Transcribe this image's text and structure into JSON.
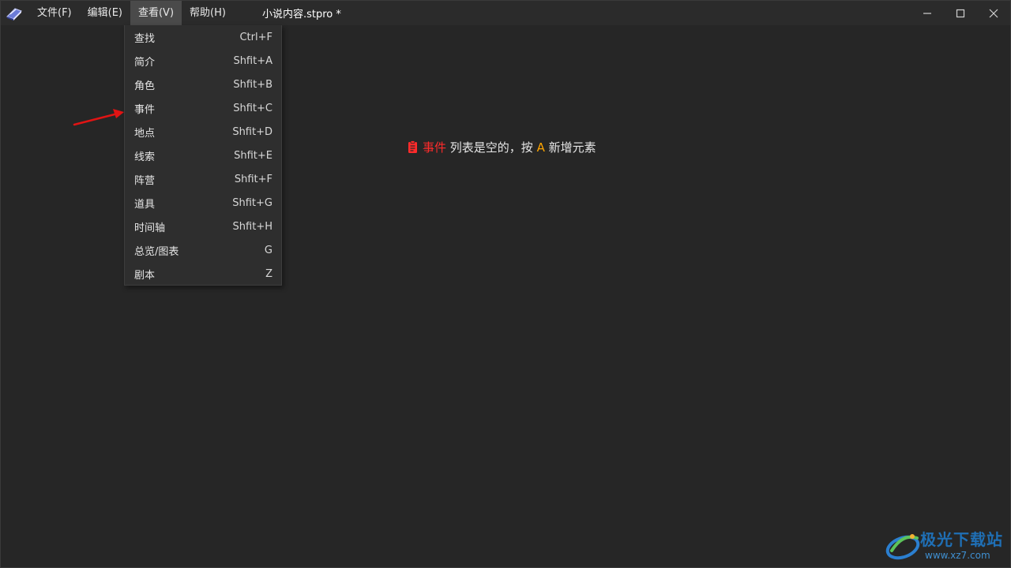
{
  "titlebar": {
    "menus": [
      {
        "label": "文件(F)"
      },
      {
        "label": "编辑(E)"
      },
      {
        "label": "查看(V)"
      },
      {
        "label": "帮助(H)"
      }
    ],
    "document_title": "小说内容.stpro *"
  },
  "view_menu": {
    "items": [
      {
        "label": "查找",
        "shortcut": "Ctrl+F"
      },
      {
        "label": "简介",
        "shortcut": "Shfit+A"
      },
      {
        "label": "角色",
        "shortcut": "Shfit+B"
      },
      {
        "label": "事件",
        "shortcut": "Shfit+C"
      },
      {
        "label": "地点",
        "shortcut": "Shfit+D"
      },
      {
        "label": "线索",
        "shortcut": "Shfit+E"
      },
      {
        "label": "阵营",
        "shortcut": "Shfit+F"
      },
      {
        "label": "道具",
        "shortcut": "Shfit+G"
      },
      {
        "label": "时间轴",
        "shortcut": "Shfit+H"
      },
      {
        "label": "总览/图表",
        "shortcut": "G"
      },
      {
        "label": "剧本",
        "shortcut": "Z"
      }
    ]
  },
  "empty_state": {
    "list_name": "事件",
    "text_part1": " 列表是空的，按 ",
    "key": "A",
    "text_part2": " 新增元素"
  },
  "watermark": {
    "name": "极光下载站",
    "url": "www.xz7.com"
  },
  "colors": {
    "background": "#262626",
    "titlebar": "#2b2b2b",
    "menu_active": "#4a4a4a",
    "dropdown": "#2e2e2e",
    "accent_red": "#ff2b2b",
    "accent_orange": "#ffa500",
    "watermark_blue": "#1f6fb5"
  },
  "icons": {
    "app": "book-icon",
    "minimize": "minimize-icon",
    "maximize": "maximize-icon",
    "close": "close-icon",
    "empty_state": "clipboard-icon",
    "annotation": "red-arrow-icon"
  }
}
